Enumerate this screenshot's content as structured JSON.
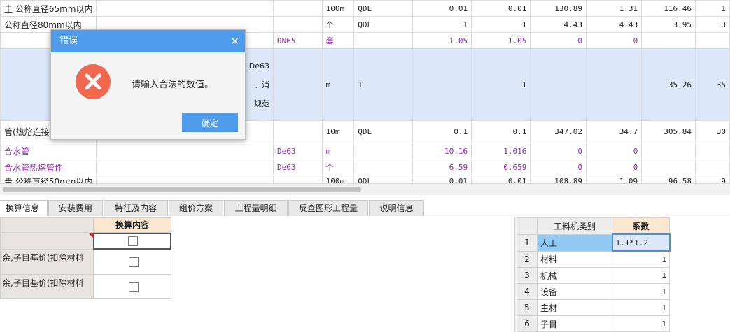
{
  "top_grid": {
    "rows": [
      {
        "c1": "圭 公称直径65mm以内",
        "c2": "",
        "c3": "",
        "c4": "100m",
        "c5": "QDL",
        "c6": "0.01",
        "c7": "0.01",
        "c8": "130.89",
        "c9": "1.31",
        "c10": "116.46",
        "c11": "1"
      },
      {
        "c1": "公称直径80mm以内",
        "c2": "",
        "c3": "",
        "c4": "个",
        "c5": "QDL",
        "c6": "1",
        "c7": "1",
        "c8": "4.43",
        "c9": "4.43",
        "c10": "3.95",
        "c11": "3"
      },
      {
        "c1": "",
        "c2": "",
        "c3": "DN65",
        "c4": "套",
        "c5": "",
        "c6": "1.05",
        "c7": "1.05",
        "c8": "0",
        "c9": "0",
        "c10": "",
        "c11": ""
      },
      {
        "c1": "",
        "c2": "De63\n、消\n规范",
        "c3": "",
        "c4": "m",
        "c5": "1",
        "c6": "",
        "c7": "1",
        "c8": "",
        "c9": "",
        "c10": "35.26",
        "c11": "35"
      },
      {
        "c1": "管(热熔连接) 么",
        "c2": "",
        "c3": "",
        "c4": "10m",
        "c5": "QDL",
        "c6": "0.1",
        "c7": "0.1",
        "c8": "347.02",
        "c9": "34.7",
        "c10": "305.84",
        "c11": "30"
      },
      {
        "c1": "合水管",
        "c2": "",
        "c3": "De63",
        "c4": "m",
        "c5": "",
        "c6": "10.16",
        "c7": "1.016",
        "c8": "0",
        "c9": "0",
        "c10": "",
        "c11": ""
      },
      {
        "c1": "合水管热熔管件",
        "c2": "",
        "c3": "De63",
        "c4": "个",
        "c5": "",
        "c6": "6.59",
        "c7": "0.659",
        "c8": "0",
        "c9": "0",
        "c10": "",
        "c11": ""
      },
      {
        "c1": "圭 公称直径50mm以内",
        "c2": "",
        "c3": "",
        "c4": "100m",
        "c5": "QDL",
        "c6": "0.01",
        "c7": "0.01",
        "c8": "108.89",
        "c9": "1.09",
        "c10": "96.58",
        "c11": "9"
      }
    ]
  },
  "tabs": [
    "换算信息",
    "安装费用",
    "特征及内容",
    "组价方案",
    "工程量明细",
    "反查图形工程量",
    "说明信息"
  ],
  "left_pane": {
    "header": "换算内容",
    "rows": [
      "",
      "余,子目基价(扣除材料",
      "余,子目基价(扣除材料"
    ]
  },
  "right_pane": {
    "header_category": "工料机类别",
    "header_coef": "系数",
    "rows": [
      {
        "n": "1",
        "cat": "人工",
        "val": "1.1*1.2"
      },
      {
        "n": "2",
        "cat": "材料",
        "val": "1"
      },
      {
        "n": "3",
        "cat": "机械",
        "val": "1"
      },
      {
        "n": "4",
        "cat": "设备",
        "val": "1"
      },
      {
        "n": "5",
        "cat": "主材",
        "val": "1"
      },
      {
        "n": "6",
        "cat": "子目",
        "val": "1"
      }
    ]
  },
  "dialog": {
    "title": "错误",
    "message": "请输入合法的数值。",
    "ok_label": "确定",
    "close_glyph": "✕",
    "icon": "error-x-icon",
    "icon_color": "#f2684e",
    "titlebar_color": "#4e9bec"
  }
}
